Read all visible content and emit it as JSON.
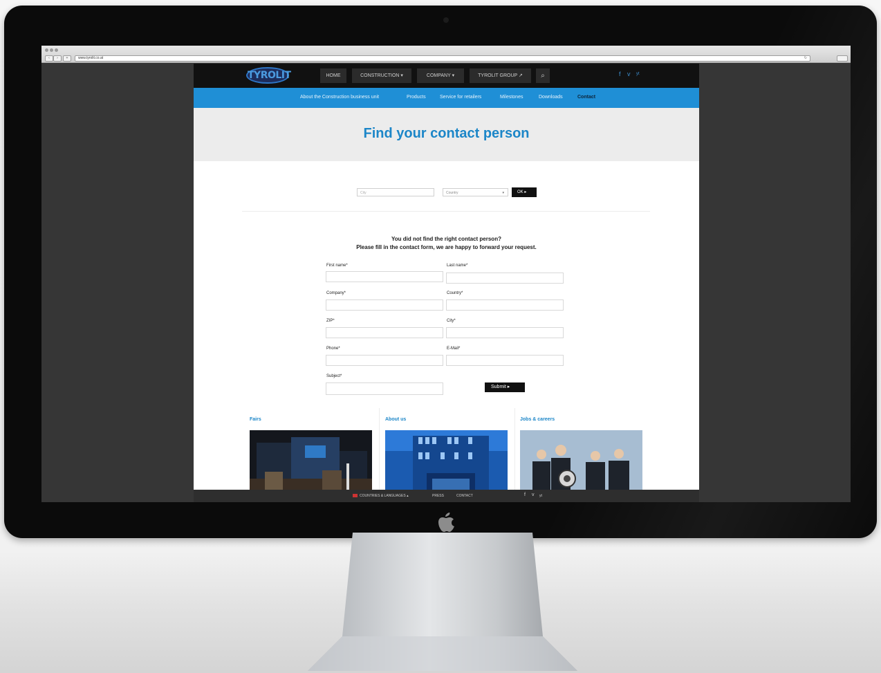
{
  "browser": {
    "url": "www.tyrolit.co.at"
  },
  "site": {
    "logo_text": "TYROLIT",
    "topnav": [
      {
        "label": "HOME"
      },
      {
        "label": "CONSTRUCTION ▾"
      },
      {
        "label": "COMPANY ▾"
      },
      {
        "label": "TYROLIT GROUP ↗"
      }
    ],
    "search_icon": "⌕",
    "social": [
      "f",
      "v",
      "yt"
    ],
    "subnav": [
      {
        "label": "About the Construction business unit"
      },
      {
        "label": "Products"
      },
      {
        "label": "Service for retailers"
      },
      {
        "label": "Milestones"
      },
      {
        "label": "Downloads"
      },
      {
        "label": "Contact",
        "active": true
      }
    ],
    "hero_title": "Find your contact person",
    "search": {
      "city_placeholder": "City",
      "country_placeholder": "Country",
      "ok_label": "OK ▸"
    },
    "notice": {
      "line1": "You did not find the right contact person?",
      "line2": "Please fill in the contact form, we are happy to forward your request."
    },
    "form": {
      "first_name": "First name*",
      "last_name": "Last name*",
      "company": "Company*",
      "country": "Country*",
      "zip": "ZIP*",
      "city": "City*",
      "phone": "Phone*",
      "email": "E-Mail*",
      "subject": "Subject*",
      "submit": "Submit ▸"
    },
    "cards": [
      {
        "title": "Fairs"
      },
      {
        "title": "About us"
      },
      {
        "title": "Jobs & careers"
      }
    ],
    "footer": {
      "countries": "COUNTRIES & LANGUAGES ▴",
      "press": "PRESS",
      "contact": "CONTACT",
      "social": [
        "f",
        "v",
        "yt"
      ]
    }
  },
  "colors": {
    "brand_blue": "#1f8fd6",
    "title_blue": "#1c86c8",
    "topbar": "#111111",
    "hero_bg": "#ececec"
  }
}
